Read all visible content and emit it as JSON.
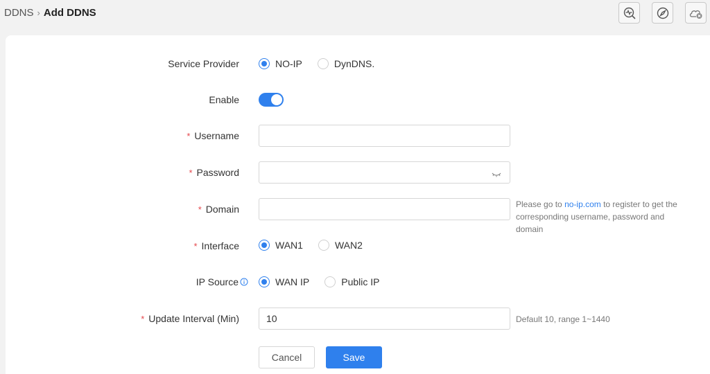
{
  "breadcrumb": {
    "parent": "DDNS",
    "separator": "›",
    "current": "Add DDNS"
  },
  "header_icons": [
    "diagnostics-icon",
    "compass-icon",
    "cloud-disconnected-icon"
  ],
  "form": {
    "service_provider": {
      "label": "Service Provider",
      "options": [
        "NO-IP",
        "DynDNS."
      ],
      "selected": "NO-IP"
    },
    "enable": {
      "label": "Enable",
      "value": true
    },
    "username": {
      "label": "Username",
      "required": "*",
      "value": ""
    },
    "password": {
      "label": "Password",
      "required": "*",
      "value": ""
    },
    "domain": {
      "label": "Domain",
      "required": "*",
      "value": "",
      "hint_prefix": "Please go to ",
      "hint_link": "no-ip.com",
      "hint_suffix": " to register to get the corresponding username, password and domain"
    },
    "interface": {
      "label": "Interface",
      "required": "*",
      "options": [
        "WAN1",
        "WAN2"
      ],
      "selected": "WAN1"
    },
    "ip_source": {
      "label": "IP Source",
      "options": [
        "WAN IP",
        "Public IP"
      ],
      "selected": "WAN IP"
    },
    "update_interval": {
      "label": "Update Interval (Min)",
      "required": "*",
      "value": "10",
      "hint": "Default 10, range 1~1440"
    }
  },
  "buttons": {
    "cancel": "Cancel",
    "save": "Save"
  },
  "colors": {
    "accent": "#2f80ed",
    "required": "#e5484d",
    "background": "#f2f2f2"
  }
}
